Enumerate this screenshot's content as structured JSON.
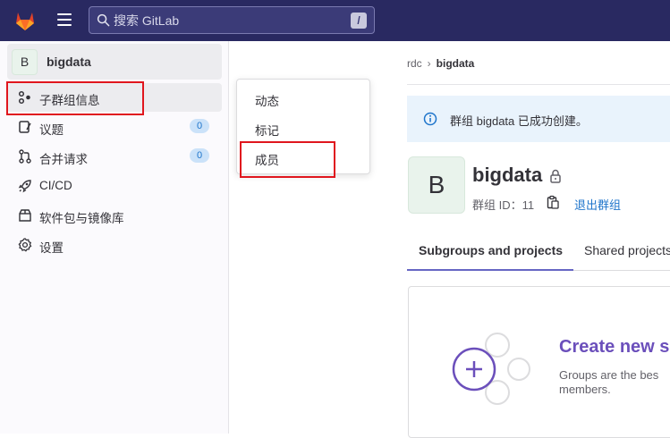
{
  "topbar": {
    "search_placeholder": "搜索 GitLab",
    "search_shortcut": "/"
  },
  "sidebar": {
    "group_avatar_letter": "B",
    "group_name": "bigdata",
    "items": [
      {
        "label": "子群组信息",
        "icon": "group-info-icon"
      },
      {
        "label": "议题",
        "icon": "issues-icon",
        "badge": "0"
      },
      {
        "label": "合并请求",
        "icon": "merge-request-icon",
        "badge": "0"
      },
      {
        "label": "CI/CD",
        "icon": "rocket-icon"
      },
      {
        "label": "软件包与镜像库",
        "icon": "package-icon"
      },
      {
        "label": "设置",
        "icon": "gear-icon"
      }
    ]
  },
  "flyout": {
    "items": [
      "动态",
      "标记",
      "成员"
    ]
  },
  "breadcrumb": {
    "parent": "rdc",
    "separator": "›",
    "current": "bigdata"
  },
  "alert": {
    "text": "群组 bigdata 已成功创建。"
  },
  "group": {
    "avatar_letter": "B",
    "title": "bigdata",
    "id_label": "群组 ID：",
    "id_value": "11",
    "leave_label": "退出群组"
  },
  "tabs": [
    {
      "label": "Subgroups and projects",
      "active": true
    },
    {
      "label": "Shared projects",
      "active": false
    }
  ],
  "empty_state": {
    "title": "Create new s",
    "description": "Groups are the bes members."
  },
  "colors": {
    "topbar": "#292961",
    "accent": "#6b4fbb",
    "highlight": "#e0161e",
    "link": "#1f75cb"
  }
}
